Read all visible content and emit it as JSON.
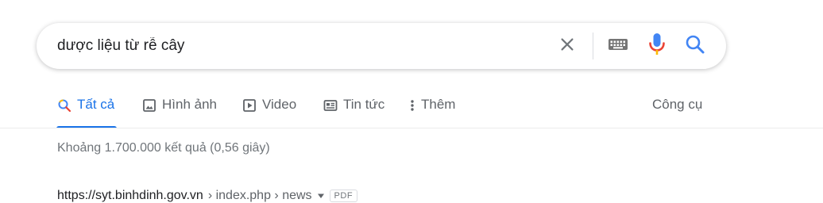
{
  "search": {
    "query": "dược liệu từ rễ cây",
    "clear_icon": "close-icon",
    "keyboard_icon": "keyboard-icon",
    "mic_icon": "mic-icon",
    "search_icon": "search-icon"
  },
  "tabs": [
    {
      "label": "Tất cả",
      "icon": "search-icon",
      "active": true
    },
    {
      "label": "Hình ảnh",
      "icon": "image-icon",
      "active": false
    },
    {
      "label": "Video",
      "icon": "play-icon",
      "active": false
    },
    {
      "label": "Tin tức",
      "icon": "news-icon",
      "active": false
    },
    {
      "label": "Thêm",
      "icon": "more-vert-icon",
      "active": false
    }
  ],
  "tools_label": "Công cụ",
  "result_stats": "Khoảng 1.700.000 kết quả (0,56 giây)",
  "first_result": {
    "domain": "https://syt.binhdinh.gov.vn",
    "path": "› index.php › news",
    "format": "PDF"
  },
  "colors": {
    "accent": "#1a73e8",
    "muted": "#5f6368",
    "mic_blue": "#4285f4",
    "mic_red": "#ea4335"
  }
}
